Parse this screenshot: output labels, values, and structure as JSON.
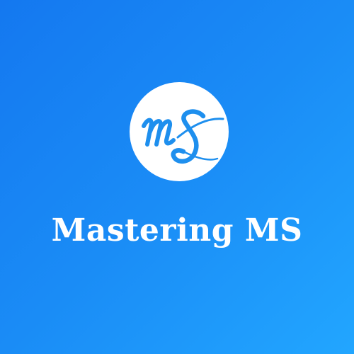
{
  "brand": {
    "name": "Mastering MS",
    "monogram": "ms"
  },
  "colors": {
    "background_start": "#1478f0",
    "background_end": "#22a6ff",
    "circle": "#ffffff",
    "monogram_stroke": "#1e8fee",
    "text": "#ffffff"
  }
}
